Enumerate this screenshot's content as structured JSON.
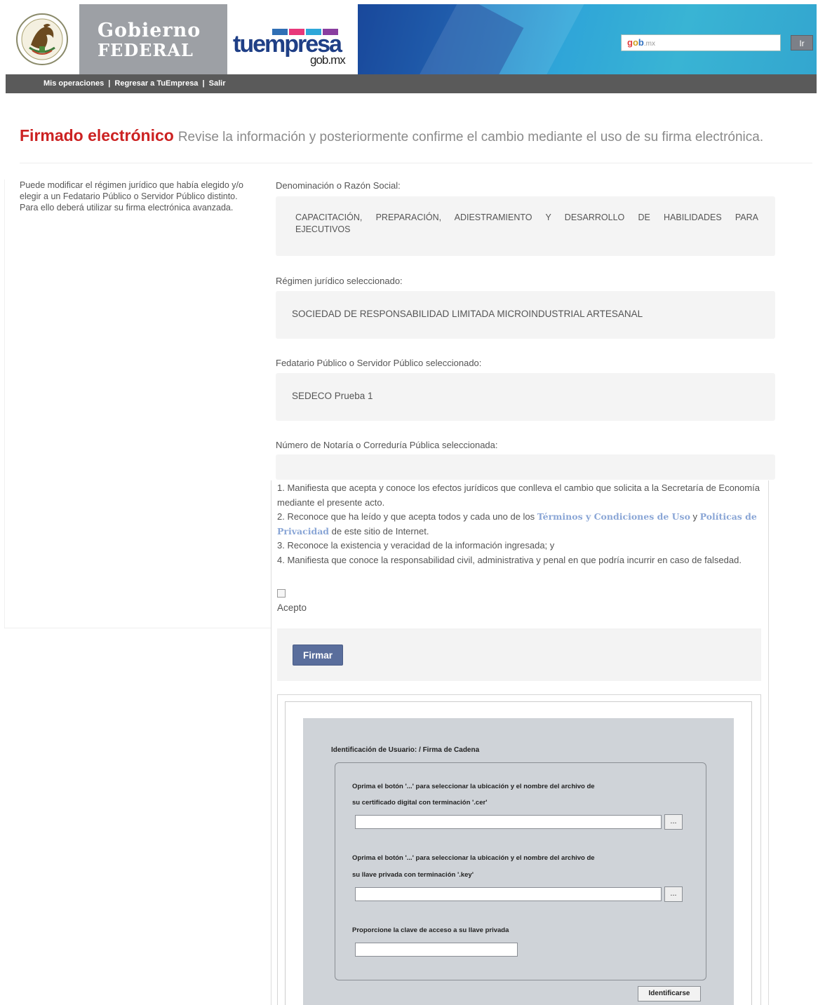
{
  "header": {
    "gob_line1": "Gobierno",
    "gob_line2": "FEDERAL",
    "tuempresa_word": "tuempresa",
    "tuempresa_sub": "gob.mx",
    "search": {
      "g": "g",
      "o": "o",
      "b": "b",
      "rest": ".mx",
      "button_label": "Ir"
    },
    "nav": [
      "Mis operaciones",
      "|",
      "Regresar a TuEmpresa",
      "|",
      "Salir"
    ],
    "colors": {
      "bar1": "#2f6fb5",
      "bar2": "#e8387a",
      "bar3": "#2ea7d9",
      "bar4": "#8a3ea0"
    }
  },
  "page": {
    "title": "Firmado electrónico",
    "subtitle": "Revise la información y posteriormente confirme el cambio mediante el uso de su firma electrónica.",
    "left_note": "Puede modificar el régimen jurídico que había elegido y/o elegir a un Fedatario Público o Servidor Público distinto. Para ello deberá utilizar su firma electrónica avanzada."
  },
  "fields": {
    "denominacion": {
      "label": "Denominación o Razón Social:",
      "value_line1": "CAPACITACIÓN, PREPARACIÓN, ADIESTRAMIENTO Y DESARROLLO DE HABILIDADES PARA",
      "value_line2": "EJECUTIVOS"
    },
    "regimen": {
      "label": "Régimen jurídico seleccionado:",
      "value": "SOCIEDAD DE RESPONSABILIDAD LIMITADA MICROINDUSTRIAL ARTESANAL"
    },
    "fedatario": {
      "label": "Fedatario Público o Servidor Público seleccionado:",
      "value": "SEDECO Prueba 1"
    },
    "notaria": {
      "label": "Número de Notaría o Correduría Pública seleccionada:",
      "value": ""
    }
  },
  "agreement": {
    "p1": "1. Manifiesta que acepta y conoce los efectos jurídicos que conlleva el cambio que solicita a la Secretaría de Economía mediante el presente acto.",
    "p2_a": "2. Reconoce que ha leído y que acepta todos y cada uno de los",
    "p2_link1": "Términos y Condiciones de Uso",
    "p2_b": "y",
    "p2_link2": "Políticas de Privacidad",
    "p2_c": "de este sitio de Internet.",
    "p3": "3. Reconoce la existencia y veracidad de la información ingresada; y",
    "p4": "4. Manifiesta que conoce la responsabilidad civil, administrativa y penal en que podría incurrir en caso de falsedad.",
    "accept_label": "Acepto",
    "sign_button": "Firmar"
  },
  "applet": {
    "title": "Identificación de Usuario: / Firma de Cadena",
    "cer_instr_1": "Oprima el botón '...' para seleccionar la ubicación y el nombre del archivo de",
    "cer_instr_2": "su certificado digital con terminación '.cer'",
    "key_instr_1": "Oprima el botón '...' para seleccionar la ubicación y el nombre del archivo de",
    "key_instr_2": "su llave privada con terminación '.key'",
    "pass_instr": "Proporcione la clave de acceso a su llave privada",
    "browse_label": "...",
    "ident_button": "Identificarse"
  }
}
